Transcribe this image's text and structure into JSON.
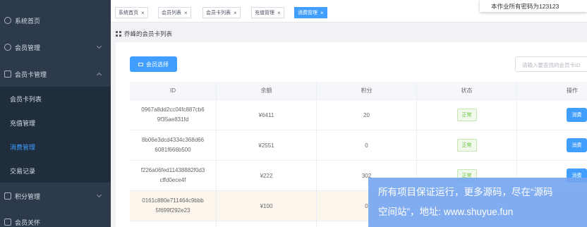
{
  "sidebar": {
    "items": [
      {
        "label": "系统首页",
        "icon": "home-icon"
      },
      {
        "label": "会员管理",
        "icon": "user-icon"
      },
      {
        "label": "会员卡管理",
        "icon": "card-icon"
      },
      {
        "label": "积分管理",
        "icon": "grid-icon"
      },
      {
        "label": "会员关怀",
        "icon": "document-icon"
      }
    ],
    "sub_items": [
      {
        "label": "会员卡列表"
      },
      {
        "label": "充值管理"
      },
      {
        "label": "消费管理",
        "active": true
      },
      {
        "label": "交易记录"
      }
    ]
  },
  "tabs": [
    {
      "label": "系统首页"
    },
    {
      "label": "会员列表"
    },
    {
      "label": "会员卡列表"
    },
    {
      "label": "充值管理"
    },
    {
      "label": "消费管理",
      "active": true
    }
  ],
  "notice": "本作业所有密码为123123",
  "breadcrumb": "乔峰的会员卡列表",
  "toolbar": {
    "select_button": "会员选择",
    "search_placeholder": "请输入要查找的会员卡ID"
  },
  "table": {
    "columns": [
      "ID",
      "余额",
      "积分",
      "状态",
      "操作"
    ],
    "rows": [
      {
        "id_line1": "0967a8dd2cc04fc887cb6",
        "id_line2": "9f35ae831fd",
        "balance": "¥6411",
        "points": "20",
        "status": "正常",
        "action": "消费"
      },
      {
        "id_line1": "8b06e3dcd4334c368d66",
        "id_line2": "6081f666b500",
        "balance": "¥2551",
        "points": "0",
        "status": "正常",
        "action": "消费"
      },
      {
        "id_line1": "f226a06fed11438882f0d3",
        "id_line2": "cffd0ece4f",
        "balance": "¥222",
        "points": "302",
        "status": "正常",
        "action": "消费"
      },
      {
        "id_line1": "0161c880e711464c9bbb",
        "id_line2": "5f699f292e23",
        "balance": "¥100",
        "points": "0",
        "status": "",
        "action": ""
      }
    ]
  },
  "watermark": {
    "line1": "所有项目保证运行，更多源码，尽在“源码",
    "line2": "空间站”，地址: www.shuyue.fun"
  },
  "colors": {
    "accent": "#409eff",
    "sidebar": "#2d3a4b",
    "status_ok": "#67c23a"
  }
}
